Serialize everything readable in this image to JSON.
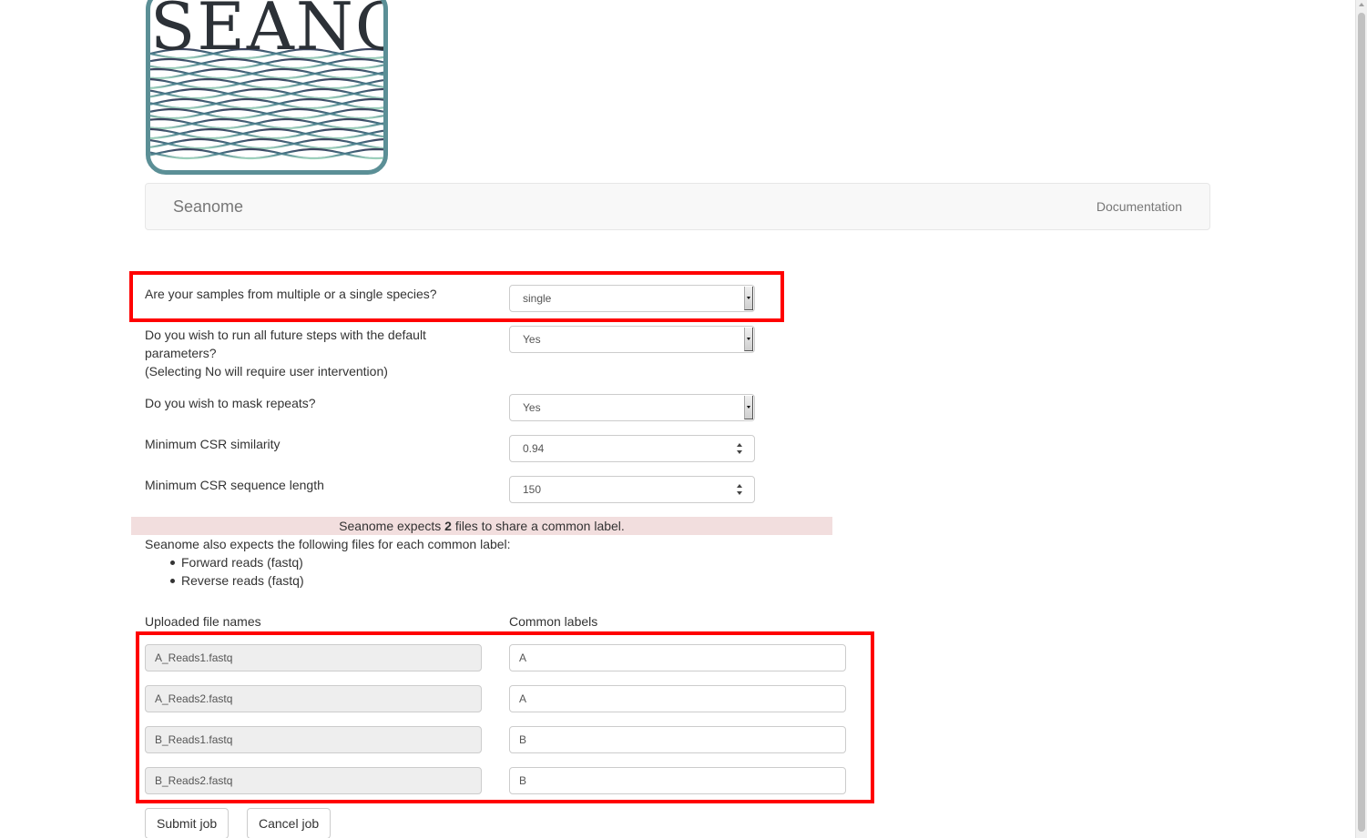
{
  "logo": {
    "text": "SEANOME",
    "border_color": "#5b8f96"
  },
  "navbar": {
    "brand": "Seanome",
    "documentation": "Documentation"
  },
  "form": {
    "species": {
      "label": "Are your samples from multiple or a single species?",
      "value": "single"
    },
    "defaults": {
      "label_line1": "Do you wish to run all future steps with the default",
      "label_line2": "parameters?",
      "label_line3": "(Selecting No will require user intervention)",
      "value": "Yes"
    },
    "mask": {
      "label": "Do you wish to mask repeats?",
      "value": "Yes"
    },
    "similarity": {
      "label": "Minimum CSR similarity",
      "value": "0.94"
    },
    "length": {
      "label": "Minimum CSR sequence length",
      "value": "150"
    }
  },
  "alert": {
    "prefix": "Seanome expects ",
    "count": "2",
    "suffix": " files to share a common label.",
    "background": "#f2dede"
  },
  "expects": {
    "intro": "Seanome also expects the following files for each common label:",
    "files": [
      "Forward reads (fastq)",
      "Reverse reads (fastq)"
    ]
  },
  "table": {
    "col_files": "Uploaded file names",
    "col_labels": "Common labels",
    "rows": [
      {
        "file": "A_Reads1.fastq",
        "label": "A"
      },
      {
        "file": "A_Reads2.fastq",
        "label": "A"
      },
      {
        "file": "B_Reads1.fastq",
        "label": "B"
      },
      {
        "file": "B_Reads2.fastq",
        "label": "B"
      }
    ]
  },
  "buttons": {
    "submit": "Submit job",
    "cancel": "Cancel job"
  },
  "highlight_color": "#ff0000"
}
